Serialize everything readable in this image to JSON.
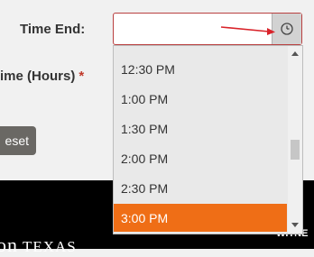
{
  "form": {
    "time_end_label": "Time End:",
    "total_time_label": "ime (Hours)",
    "required_marker": "*",
    "reset_label": "eset"
  },
  "time_input": {
    "value": "",
    "icon": "clock-icon"
  },
  "dropdown": {
    "options": [
      "12:30 PM",
      "1:00 PM",
      "1:30 PM",
      "2:00 PM",
      "2:30 PM",
      "3:00 PM"
    ],
    "selected": "3:00 PM"
  },
  "footer": {
    "brand_on": "on",
    "brand_texas": "TEXAS",
    "witness_text": "WITNE"
  },
  "colors": {
    "selected_bg": "#ef6e16",
    "input_border": "#b94040",
    "annotation_arrow": "#d9232a"
  }
}
